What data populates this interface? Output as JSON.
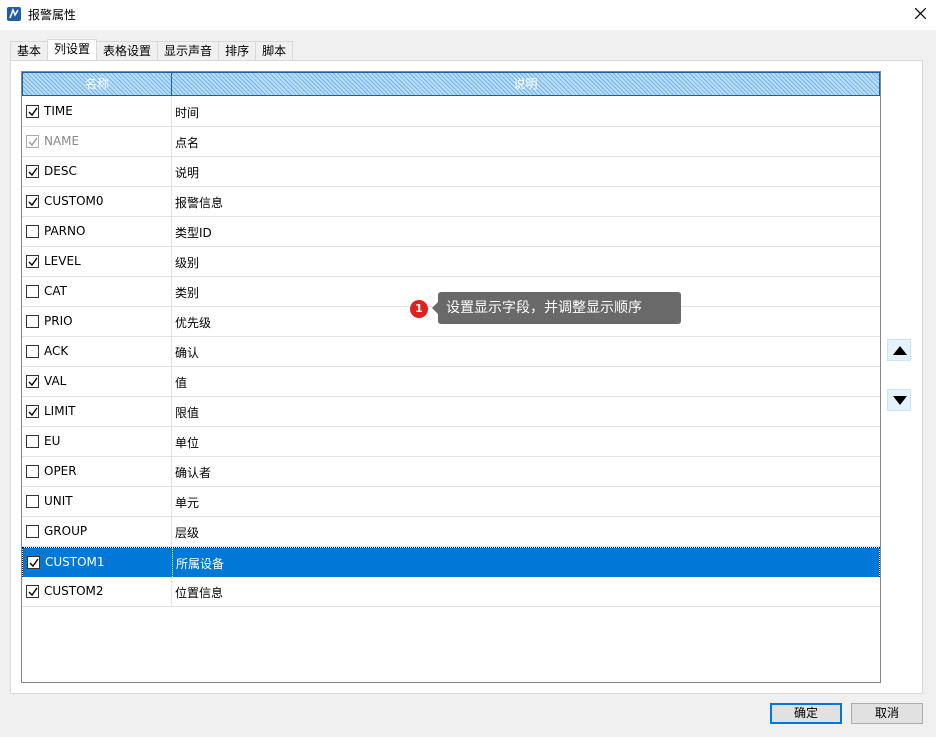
{
  "window": {
    "title": "报警属性"
  },
  "tabs": [
    "基本",
    "列设置",
    "表格设置",
    "显示声音",
    "排序",
    "脚本"
  ],
  "active_tab": "列设置",
  "grid": {
    "headers": [
      "名称",
      "说明"
    ],
    "rows": [
      {
        "name": "TIME",
        "desc": "时间",
        "checked": true
      },
      {
        "name": "NAME",
        "desc": "点名",
        "checked": true,
        "disabled": true
      },
      {
        "name": "DESC",
        "desc": "说明",
        "checked": true
      },
      {
        "name": "CUSTOM0",
        "desc": "报警信息",
        "checked": true
      },
      {
        "name": "PARNO",
        "desc": "类型ID",
        "checked": false
      },
      {
        "name": "LEVEL",
        "desc": "级别",
        "checked": true
      },
      {
        "name": "CAT",
        "desc": "类别",
        "checked": false
      },
      {
        "name": "PRIO",
        "desc": "优先级",
        "checked": false
      },
      {
        "name": "ACK",
        "desc": "确认",
        "checked": false
      },
      {
        "name": "VAL",
        "desc": "值",
        "checked": true
      },
      {
        "name": "LIMIT",
        "desc": "限值",
        "checked": true
      },
      {
        "name": "EU",
        "desc": "单位",
        "checked": false
      },
      {
        "name": "OPER",
        "desc": "确认者",
        "checked": false
      },
      {
        "name": "UNIT",
        "desc": "单元",
        "checked": false
      },
      {
        "name": "GROUP",
        "desc": "层级",
        "checked": false
      },
      {
        "name": "CUSTOM1",
        "desc": "所属设备",
        "checked": true,
        "selected": true
      },
      {
        "name": "CUSTOM2",
        "desc": "位置信息",
        "checked": true
      }
    ]
  },
  "tooltip": {
    "step": "1",
    "text": "设置显示字段，并调整显示顺序"
  },
  "side_buttons": {
    "up_icon": "triangle-up-icon",
    "down_icon": "triangle-down-icon"
  },
  "buttons": {
    "ok": "确定",
    "cancel": "取消"
  },
  "colors": {
    "selection": "#0078d7",
    "header": "#77b6ea",
    "badge": "#e02020"
  }
}
